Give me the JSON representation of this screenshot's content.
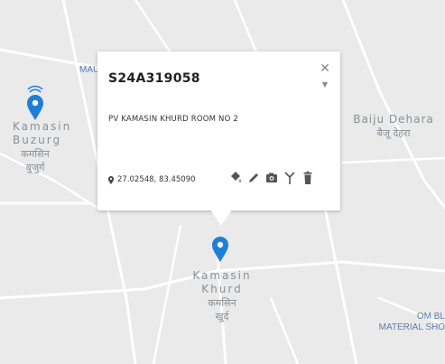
{
  "map": {
    "background": "#eaeaea",
    "road_color": "#ffffff",
    "places": [
      {
        "name": "Kamasin Buzurg",
        "line1": "Kamasin",
        "line2": "Buzurg",
        "dev1": "कमसिन",
        "dev2": "बुजुर्ग"
      },
      {
        "name": "Baiju Dehara",
        "line1": "Baiju Dehara",
        "dev1": "बैजू देहरा"
      },
      {
        "name": "Kamasin Khurd",
        "line1": "Kamasin",
        "line2": "Khurd",
        "dev1": "कमसिन",
        "dev2": "खुर्द"
      }
    ],
    "poi": [
      {
        "label": "MAU"
      },
      {
        "label_line1": "OM BL",
        "label_line2": "MATERIAL SHO"
      }
    ],
    "marker_color": "#1e7fd6",
    "marker_icon": "map-pin-icon"
  },
  "popup": {
    "title": "S24A319058",
    "address": "PV KAMASIN KHURD ROOM NO 2",
    "coordinates": "27.02548, 83.45090",
    "close_symbol": "✕",
    "actions": [
      {
        "name": "fill-icon"
      },
      {
        "name": "edit-icon"
      },
      {
        "name": "camera-icon"
      },
      {
        "name": "antenna-icon"
      },
      {
        "name": "delete-icon"
      }
    ]
  }
}
